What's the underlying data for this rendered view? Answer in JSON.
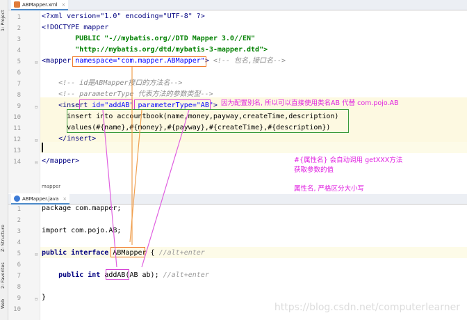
{
  "sidebar": {
    "project_tab": "1: Project",
    "structure_tab": "Z: Structure",
    "favorites_tab": "2: Favorites",
    "web_tab": "Web"
  },
  "xml_editor": {
    "tab_label": "ABMapper.xml",
    "line_numbers": [
      "1",
      "2",
      "3",
      "4",
      "5",
      "6",
      "7",
      "8",
      "9",
      "10",
      "11",
      "12",
      "13",
      "14"
    ],
    "lines": {
      "l1": "<?xml version=\"1.0\" encoding=\"UTF-8\" ?>",
      "l2": "<!DOCTYPE mapper",
      "l3": "        PUBLIC \"-//mybatis.org//DTD Mapper 3.0//EN\"",
      "l4": "        \"http://mybatis.org/dtd/mybatis-3-mapper.dtd\">",
      "l5_tag": "<mapper ",
      "l5_attr": "namespace=\"com.mapper.ABMapper\"",
      "l5_end": ">",
      "l5_comment": " <!-- 包名,接口名-->",
      "l7": "    <!-- id是ABMapper接口的方法名-->",
      "l8": "    <!-- parameterType 代表方法的参数类型-->",
      "l9_tag": "    <insert ",
      "l9_id": "id=\"addAB\"",
      "l9_sp": " ",
      "l9_ptype": "parameterType=\"AB\"",
      "l9_end": ">",
      "l10": "      insert into accountbook(name,money,payway,createTime,description)",
      "l11": "      values(#{name},#{money},#{payway},#{createTime},#{description})",
      "l12": "    </insert>",
      "l14": "</mapper>"
    },
    "breadcrumb": "mapper"
  },
  "java_editor": {
    "tab_label": "ABMapper.java",
    "line_numbers": [
      "1",
      "2",
      "3",
      "4",
      "5",
      "6",
      "7",
      "8",
      "9",
      "10"
    ],
    "lines": {
      "l1": "package com.mapper;",
      "l3": "import com.pojo.AB;",
      "l5_kw": "public interface ",
      "l5_name": "ABMapper",
      "l5_rest": " { ",
      "l5_comment": "//alt+enter",
      "l7_kw": "    public int ",
      "l7_name": "addAB",
      "l7_rest": "(AB ab); ",
      "l7_comment": "//alt+enter",
      "l9": "}"
    }
  },
  "annotations": {
    "alias_note": "因为配置别名, 所以可以直接使用类名AB 代替 com.pojo.AB",
    "getter_note_1": "#{属性名} 会自动调用 getXXX方法",
    "getter_note_2": "获取参数的值",
    "case_note": "属性名, 严格区分大小写"
  },
  "watermark": "https://blog.csdn.net/computerlearner",
  "colors": {
    "annotation": "#e020e0",
    "box_orange": "#f07a2a",
    "box_magenta": "#d43fd4",
    "box_green": "#3a9a3a",
    "arrow_orange": "#f0a050",
    "arrow_magenta": "#e060e0"
  }
}
